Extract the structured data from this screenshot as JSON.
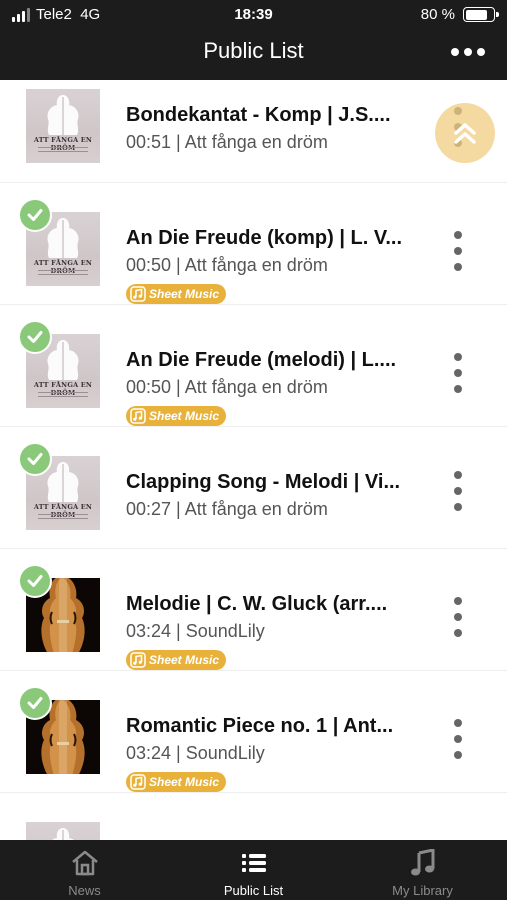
{
  "status_bar": {
    "carrier": "Tele2",
    "network": "4G",
    "time": "18:39",
    "battery": "80 %",
    "battery_level": 0.8
  },
  "header": {
    "title": "Public List",
    "menu_icon": "more-horizontal-icon"
  },
  "album_cover": {
    "title": "ATT FÅNGA EN DRÖM"
  },
  "badge_label": "Sheet Music",
  "tracks": [
    {
      "title": "Bondekantat - Komp | J.S....",
      "duration": "00:51",
      "album": "Att fånga en dröm",
      "downloaded": false,
      "sheet_music": false,
      "cover": "album"
    },
    {
      "title": "An Die Freude (komp) | L. V...",
      "duration": "00:50",
      "album": "Att fånga en dröm",
      "downloaded": true,
      "sheet_music": true,
      "cover": "album"
    },
    {
      "title": "An Die Freude (melodi) | L....",
      "duration": "00:50",
      "album": "Att fånga en dröm",
      "downloaded": true,
      "sheet_music": true,
      "cover": "album"
    },
    {
      "title": "Clapping Song - Melodi | Vi...",
      "duration": "00:27",
      "album": "Att fånga en dröm",
      "downloaded": true,
      "sheet_music": false,
      "cover": "album"
    },
    {
      "title": "Melodie | C. W. Gluck (arr....",
      "duration": "03:24",
      "album": "SoundLily",
      "downloaded": true,
      "sheet_music": true,
      "cover": "violin"
    },
    {
      "title": "Romantic Piece no. 1 | Ant...",
      "duration": "03:24",
      "album": "SoundLily",
      "downloaded": true,
      "sheet_music": true,
      "cover": "violin"
    },
    {
      "title": "",
      "duration": "",
      "album": "",
      "downloaded": false,
      "sheet_music": false,
      "cover": "album"
    }
  ],
  "scroll_to_top_icon": "double-chevron-up-icon",
  "tabs": [
    {
      "label": "News",
      "icon": "home-icon",
      "active": false
    },
    {
      "label": "Public List",
      "icon": "list-icon",
      "active": true
    },
    {
      "label": "My Library",
      "icon": "music-note-icon",
      "active": false
    }
  ],
  "colors": {
    "bar_background": "#1c1c1c",
    "check_green": "#8bc97a",
    "badge_orange": "#e8b23a",
    "scroll_top_button": "#f0cd82"
  }
}
